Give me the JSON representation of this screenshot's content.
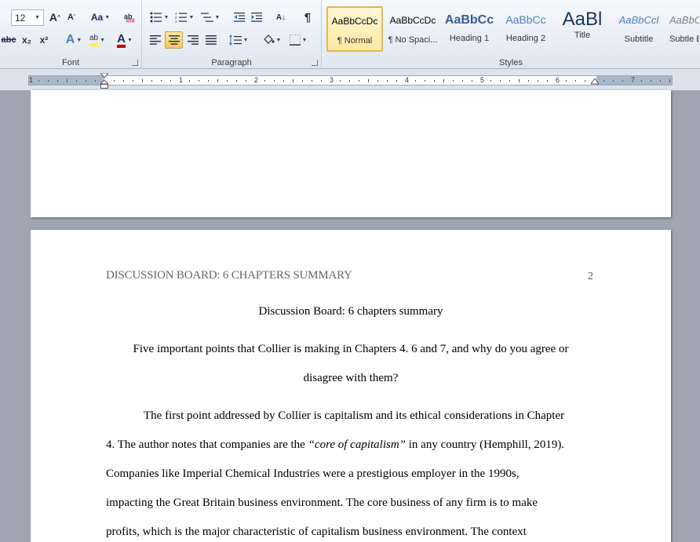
{
  "ribbon": {
    "font_group_label": "Font",
    "paragraph_group_label": "Paragraph",
    "styles_group_label": "Styles",
    "font_size": "12",
    "grow_font_glyph": "A",
    "shrink_font_glyph": "A",
    "change_case_glyph": "Aa",
    "strikethrough_glyph": "abc",
    "subscript_glyph": "x₂",
    "superscript_glyph": "x²",
    "text_effects_glyph": "A",
    "highlight_glyph": "ab",
    "font_color_glyph": "A",
    "pilcrow_glyph": "¶",
    "sort_glyph": "A↓",
    "styles": [
      {
        "sample": "AaBbCcDc",
        "name": "¶ Normal"
      },
      {
        "sample": "AaBbCcDc",
        "name": "¶ No Spaci..."
      },
      {
        "sample": "AaBbCc",
        "name": "Heading 1"
      },
      {
        "sample": "AaBbCc",
        "name": "Heading 2"
      },
      {
        "sample": "AaBl",
        "name": "Title"
      },
      {
        "sample": "AaBbCcl",
        "name": "Subtitle"
      },
      {
        "sample": "AaBbCcl",
        "name": "Subtle E"
      }
    ],
    "colors": {
      "heading": "#365f91",
      "title": "#17365d",
      "subtitle": "#4f81bd",
      "accent_red": "#c00000",
      "highlight": "#ffff00"
    }
  },
  "ruler": {
    "numbers": [
      "1",
      "1",
      "2",
      "3",
      "4",
      "5",
      "6",
      "7"
    ]
  },
  "document": {
    "running_head": "DISCUSSION BOARD: 6 CHAPTERS SUMMARY",
    "page_number": "2",
    "title": "Discussion Board: 6 chapters summary",
    "question_line1": "Five important points that Collier is making in Chapters 4. 6 and 7, and why do you agree or",
    "question_line2": "disagree with them?",
    "body_line1": "The first point addressed by Collier is capitalism and its ethical considerations in Chapter",
    "body_line2_a": "4. The author notes that companies are the ",
    "body_line2_quote": "“core of capitalism”",
    "body_line2_b": " in any country (Hemphill, 2019).",
    "body_line3": "Companies like Imperial Chemical Industries were a prestigious employer in the 1990s,",
    "body_line4": "impacting the Great Britain business environment. The core business of any firm is to make",
    "body_line5": "profits, which is the major characteristic of capitalism business environment. The context"
  }
}
